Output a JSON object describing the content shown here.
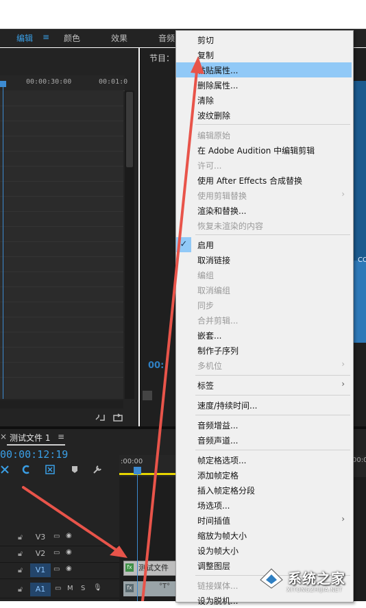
{
  "workspace": {
    "items": [
      "编辑",
      "颜色",
      "效果",
      "音频"
    ],
    "menu_icon": "≡"
  },
  "source_panel": {
    "timecodes": [
      "00:00:30:00",
      "00:01:0"
    ]
  },
  "program_panel": {
    "title": "节目：",
    "timecode": "00:",
    "video_text": "CO"
  },
  "timeline": {
    "close": "×",
    "tab": "测试文件 1",
    "tab_menu": "≡",
    "timecode": "00:00:12:19",
    "ruler_start": ":00:00",
    "ruler_end": "00:0",
    "tracks": [
      {
        "name": "V3",
        "active": false
      },
      {
        "name": "V2",
        "active": false
      },
      {
        "name": "V1",
        "active": true
      },
      {
        "name": "A1",
        "active": true
      }
    ],
    "audio_controls": [
      "M",
      "S"
    ],
    "clip_name": "测试文件",
    "clip_fx": "fx",
    "clip2_text": "°T°"
  },
  "context_menu": {
    "items": [
      {
        "label": "剪切",
        "disabled": false
      },
      {
        "label": "复制",
        "disabled": false
      },
      {
        "label": "粘贴属性...",
        "disabled": false,
        "highlighted": true
      },
      {
        "label": "删除属性...",
        "disabled": false
      },
      {
        "label": "清除",
        "disabled": false
      },
      {
        "label": "波纹删除",
        "disabled": false
      },
      {
        "label": "编辑原始",
        "disabled": true
      },
      {
        "label": "在 Adobe Audition 中编辑剪辑",
        "disabled": false
      },
      {
        "label": "许可...",
        "disabled": true
      },
      {
        "label": "使用 After Effects 合成替换",
        "disabled": false
      },
      {
        "label": "使用剪辑替换",
        "disabled": true,
        "submenu": true
      },
      {
        "label": "渲染和替换...",
        "disabled": false
      },
      {
        "label": "恢复未渲染的内容",
        "disabled": true
      },
      {
        "label": "启用",
        "disabled": false,
        "checked": true
      },
      {
        "label": "取消链接",
        "disabled": false
      },
      {
        "label": "编组",
        "disabled": true
      },
      {
        "label": "取消编组",
        "disabled": true
      },
      {
        "label": "同步",
        "disabled": true
      },
      {
        "label": "合并剪辑...",
        "disabled": true
      },
      {
        "label": "嵌套...",
        "disabled": false
      },
      {
        "label": "制作子序列",
        "disabled": false
      },
      {
        "label": "多机位",
        "disabled": true,
        "submenu": true
      },
      {
        "label": "标签",
        "disabled": false,
        "submenu": true
      },
      {
        "label": "速度/持续时间...",
        "disabled": false
      },
      {
        "label": "音频增益...",
        "disabled": false
      },
      {
        "label": "音频声道...",
        "disabled": false
      },
      {
        "label": "帧定格选项...",
        "disabled": false
      },
      {
        "label": "添加帧定格",
        "disabled": false
      },
      {
        "label": "插入帧定格分段",
        "disabled": false
      },
      {
        "label": "场选项...",
        "disabled": false
      },
      {
        "label": "时间插值",
        "disabled": false,
        "submenu": true
      },
      {
        "label": "缩放为帧大小",
        "disabled": false
      },
      {
        "label": "设为帧大小",
        "disabled": false
      },
      {
        "label": "调整图层",
        "disabled": false
      },
      {
        "label": "链接媒体...",
        "disabled": true
      },
      {
        "label": "设为脱机...",
        "disabled": false
      }
    ],
    "submenu_arrow": "›",
    "check_mark": "✓"
  },
  "watermark": {
    "text": "系统之家",
    "url": "XITONGZHIJIA.NET"
  },
  "colors": {
    "accent": "#3a9fe6",
    "menu_highlight": "#91c9f7",
    "arrow": "#e8544a"
  }
}
